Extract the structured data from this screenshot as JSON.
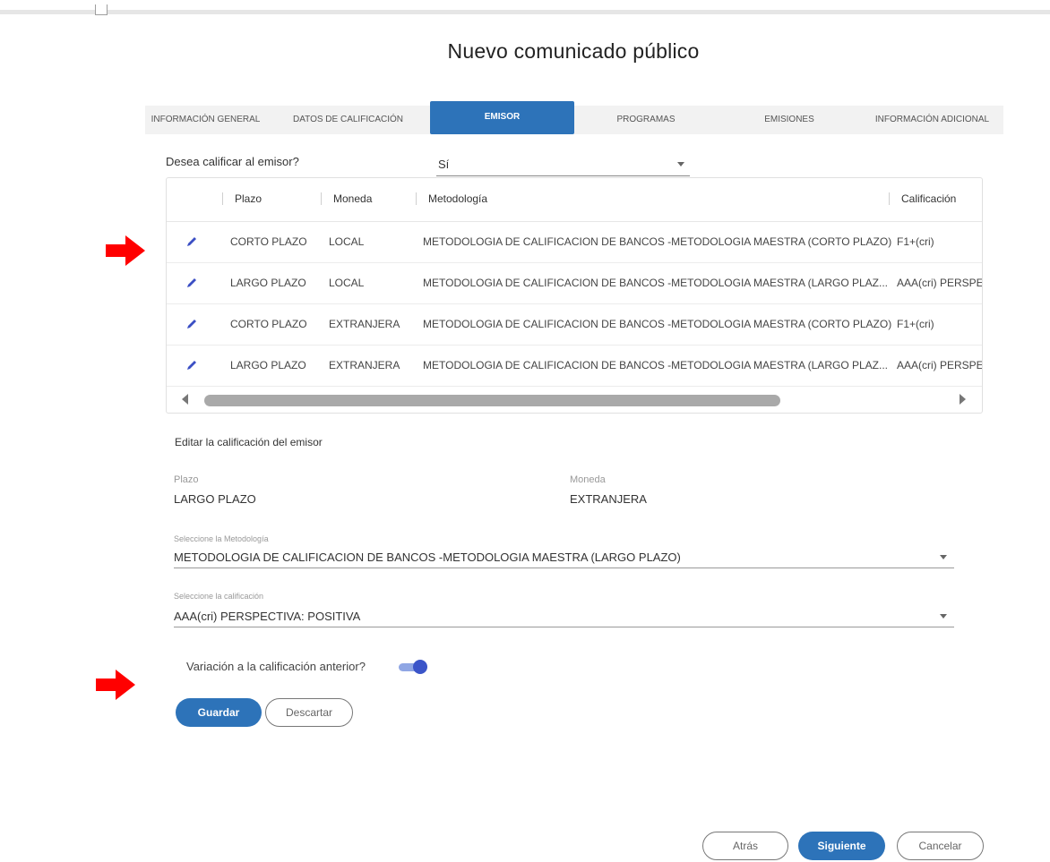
{
  "page": {
    "title": "Nuevo comunicado público"
  },
  "tabs": [
    {
      "label": "INFORMACIÓN GENERAL"
    },
    {
      "label": "DATOS DE CALIFICACIÓN"
    },
    {
      "label": "EMISOR",
      "active": true
    },
    {
      "label": "PROGRAMAS"
    },
    {
      "label": "EMISIONES"
    },
    {
      "label": "INFORMACIÓN ADICIONAL"
    }
  ],
  "question": {
    "label": "Desea calificar al emisor?",
    "value": "Sí"
  },
  "grid": {
    "headers": {
      "plazo": "Plazo",
      "moneda": "Moneda",
      "metodologia": "Metodología",
      "calificacion": "Calificación"
    },
    "rows": [
      {
        "plazo": "CORTO PLAZO",
        "moneda": "LOCAL",
        "metodologia": "METODOLOGIA DE CALIFICACION DE BANCOS -METODOLOGIA MAESTRA (CORTO PLAZO)",
        "calificacion": "F1+(cri)"
      },
      {
        "plazo": "LARGO PLAZO",
        "moneda": "LOCAL",
        "metodologia": "METODOLOGIA DE CALIFICACION DE BANCOS -METODOLOGIA MAESTRA (LARGO PLAZ...",
        "calificacion": "AAA(cri) PERSPE"
      },
      {
        "plazo": "CORTO PLAZO",
        "moneda": "EXTRANJERA",
        "metodologia": "METODOLOGIA DE CALIFICACION DE BANCOS -METODOLOGIA MAESTRA (CORTO PLAZO)",
        "calificacion": "F1+(cri)"
      },
      {
        "plazo": "LARGO PLAZO",
        "moneda": "EXTRANJERA",
        "metodologia": "METODOLOGIA DE CALIFICACION DE BANCOS -METODOLOGIA MAESTRA (LARGO PLAZ...",
        "calificacion": "AAA(cri) PERSPE"
      }
    ]
  },
  "edit": {
    "title": "Editar la calificación del emisor",
    "plazo_label": "Plazo",
    "plazo_value": "LARGO PLAZO",
    "moneda_label": "Moneda",
    "moneda_value": "EXTRANJERA",
    "metodologia_label": "Seleccione la Metodología",
    "metodologia_value": "METODOLOGIA DE CALIFICACION DE BANCOS -METODOLOGIA MAESTRA (LARGO PLAZO)",
    "calificacion_label": "Seleccione la calificación",
    "calificacion_value": "AAA(cri) PERSPECTIVA: POSITIVA",
    "toggle_label": "Variación a la calificación anterior?",
    "toggle_on": true,
    "save_label": "Guardar",
    "discard_label": "Descartar"
  },
  "footer": {
    "back_label": "Atrás",
    "next_label": "Siguiente",
    "cancel_label": "Cancelar"
  },
  "colors": {
    "primary": "#2d73b9",
    "annotation_arrow": "#ff0000",
    "toggle": "#3b55c9"
  },
  "icons": {
    "row_edit": "pencil-icon",
    "annotation": "red-arrow-icon"
  }
}
